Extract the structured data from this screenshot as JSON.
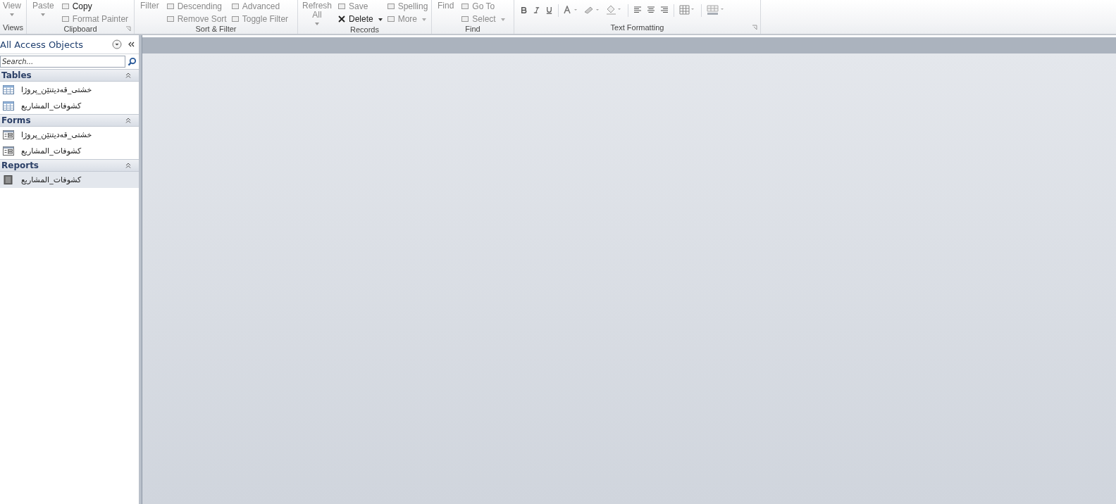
{
  "ribbon": {
    "groups": [
      {
        "kind": "commands",
        "label": "Views",
        "launcher": false,
        "large": [
          {
            "label": "View",
            "dropdown": true,
            "enabled": false
          }
        ]
      },
      {
        "kind": "commands",
        "label": "Clipboard",
        "launcher": true,
        "large": [
          {
            "label": "Paste",
            "dropdown": true,
            "enabled": false
          }
        ],
        "columns": [
          [
            {
              "label": "Copy",
              "dropdown": false,
              "enabled": true
            },
            {
              "label": "Format Painter",
              "dropdown": false,
              "enabled": false
            }
          ]
        ]
      },
      {
        "kind": "commands",
        "label": "Sort & Filter",
        "launcher": false,
        "large": [
          {
            "label": "Filter",
            "dropdown": false,
            "enabled": false
          }
        ],
        "columns": [
          [
            {
              "label": "Descending",
              "dropdown": false,
              "enabled": false
            },
            {
              "label": "Remove Sort",
              "dropdown": false,
              "enabled": false
            }
          ],
          [
            {
              "label": "Advanced",
              "dropdown": false,
              "enabled": false
            },
            {
              "label": "Toggle Filter",
              "dropdown": false,
              "enabled": false
            }
          ]
        ]
      },
      {
        "kind": "commands",
        "label": "Records",
        "launcher": false,
        "large": [
          {
            "label": "Refresh All",
            "dropdown": true,
            "enabled": false
          }
        ],
        "columns": [
          [
            {
              "label": "Save",
              "dropdown": false,
              "enabled": false
            },
            {
              "label": "Delete",
              "dropdown": true,
              "enabled": true
            }
          ],
          [
            {
              "label": "Spelling",
              "dropdown": false,
              "enabled": false
            },
            {
              "label": "More",
              "dropdown": true,
              "enabled": false
            }
          ]
        ]
      },
      {
        "kind": "commands",
        "label": "Find",
        "launcher": false,
        "large": [
          {
            "label": "Find",
            "dropdown": false,
            "enabled": false
          }
        ],
        "columns": [
          [
            {
              "label": "Go To",
              "dropdown": false,
              "enabled": false
            },
            {
              "label": "Select",
              "dropdown": true,
              "enabled": false
            }
          ]
        ]
      },
      {
        "kind": "formatting",
        "label": "Text Formatting",
        "launcher": true
      }
    ]
  },
  "navigation": {
    "title": "All Access Objects",
    "search": {
      "placeholder": "Search..."
    },
    "sections": [
      {
        "title": "Tables",
        "expanded": true,
        "items": [
          {
            "kind": "table",
            "label": "خشتی_قەدیتنێن_پروژا",
            "selected": false
          },
          {
            "kind": "table",
            "label": "كشوفات_المشاريع",
            "selected": false
          }
        ]
      },
      {
        "title": "Forms",
        "expanded": true,
        "items": [
          {
            "kind": "form",
            "label": "خشتی_قەدیتنێن_پروژا",
            "selected": false
          },
          {
            "kind": "form",
            "label": "كشوفات_المشاريع",
            "selected": false
          }
        ]
      },
      {
        "title": "Reports",
        "expanded": true,
        "items": [
          {
            "kind": "report",
            "label": "كشوفات_المشاريع",
            "selected": true
          }
        ]
      }
    ]
  }
}
